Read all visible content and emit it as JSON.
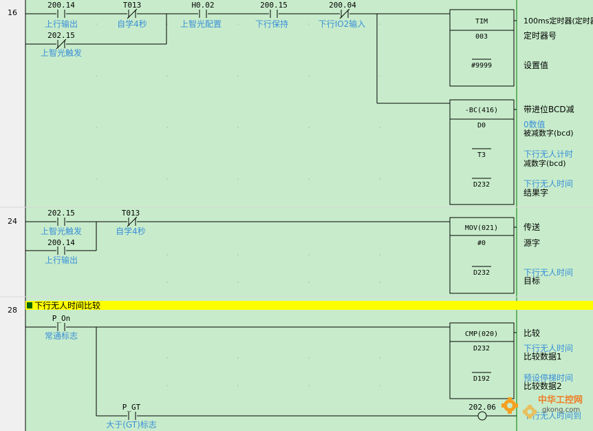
{
  "colors": {
    "background": "#c8eccb",
    "gutter": "#f0f0f0",
    "wire": "#000000",
    "comment": "#3a8fd8",
    "highlight": "#ffff00",
    "section_marker": "#006400",
    "power_rail": "#008000"
  },
  "rungs": [
    {
      "step": "16",
      "contacts": [
        {
          "address": "200.14",
          "comment": "上行输出",
          "type": "no"
        },
        {
          "address": "T013",
          "comment": "自学4秒",
          "type": "nc"
        },
        {
          "address": "H0.02",
          "comment": "上智光配置",
          "type": "no"
        },
        {
          "address": "200.15",
          "comment": "下行保持",
          "type": "no"
        },
        {
          "address": "200.04",
          "comment": "下行IO2输入",
          "type": "nc"
        },
        {
          "address": "202.15",
          "comment": "上智光触发",
          "type": "nc"
        }
      ],
      "instructions": [
        {
          "name": "TIM",
          "desc": "100ms定时器(定时器",
          "operands": [
            {
              "value": "003",
              "label": "定时器号",
              "comment": "",
              "overline": false
            },
            {
              "value": "#9999",
              "label": "设置值",
              "comment": "",
              "overline": true
            }
          ]
        },
        {
          "name": "-BC(416)",
          "desc": "带进位BCD减",
          "operands": [
            {
              "value": "D0",
              "label": "被减数字(bcd)",
              "comment": "0数值",
              "overline": false
            },
            {
              "value": "T3",
              "label": "减数字(bcd)",
              "comment": "下行无人计时",
              "overline": true
            },
            {
              "value": "D232",
              "label": "结果字",
              "comment": "下行无人时间",
              "overline": true
            }
          ]
        }
      ]
    },
    {
      "step": "24",
      "contacts": [
        {
          "address": "202.15",
          "comment": "上智光触发",
          "type": "no"
        },
        {
          "address": "T013",
          "comment": "自学4秒",
          "type": "nc"
        },
        {
          "address": "200.14",
          "comment": "上行输出",
          "type": "no"
        }
      ],
      "instructions": [
        {
          "name": "MOV(021)",
          "desc": "传送",
          "operands": [
            {
              "value": "#0",
              "label": "源字",
              "comment": "",
              "overline": false
            },
            {
              "value": "D232",
              "label": "目标",
              "comment": "下行无人时间",
              "overline": true
            }
          ]
        }
      ]
    },
    {
      "step": "28",
      "section_title": "下行无人时间比较",
      "contacts": [
        {
          "address": "P_On",
          "comment": "常通标志",
          "type": "no"
        },
        {
          "address": "P_GT",
          "comment": "大于(GT)标志",
          "type": "no"
        }
      ],
      "instructions": [
        {
          "name": "CMP(020)",
          "desc": "比较",
          "operands": [
            {
              "value": "D232",
              "label": "比较数据1",
              "comment": "下行无人时间",
              "overline": false
            },
            {
              "value": "D192",
              "label": "比较数据2",
              "comment": "预设停梯时间",
              "overline": true
            }
          ]
        }
      ],
      "coils": [
        {
          "address": "202.06",
          "comment": "下行无人时间到"
        }
      ]
    }
  ],
  "watermark": {
    "brand": "中华工控网",
    "domain": "gkong.com"
  }
}
